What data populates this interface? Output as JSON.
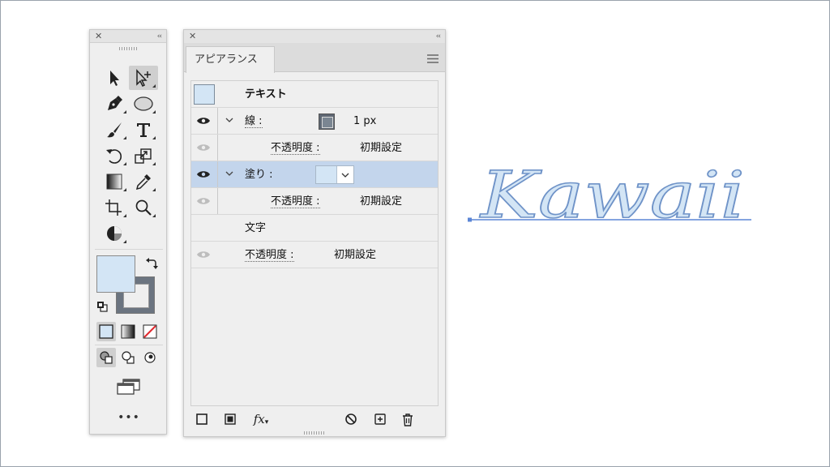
{
  "tools_panel": {
    "close_glyph": "✕",
    "collapse_glyph": "‹‹",
    "more_glyph": "•••",
    "icons": [
      "selection-tool-icon",
      "direct-selection-tool-icon",
      "pen-tool-icon",
      "ellipse-tool-icon",
      "paintbrush-tool-icon",
      "type-tool-icon",
      "rotate-tool-icon",
      "scale-tool-icon",
      "gradient-tool-icon",
      "eyedropper-tool-icon",
      "artboard-tool-icon",
      "zoom-tool-icon",
      "shape-builder-icon"
    ],
    "fill_color": "#d3e5f5",
    "stroke_color": "#6b7480"
  },
  "appearance_panel": {
    "close_glyph": "✕",
    "collapse_glyph": "‹‹",
    "tab_label": "アピアランス",
    "object_title": "テキスト",
    "rows": {
      "stroke_label": "線 :",
      "stroke_value": "1 px",
      "stroke_opacity_label": "不透明度 :",
      "stroke_opacity_value": "初期設定",
      "fill_label": "塗り :",
      "fill_opacity_label": "不透明度 :",
      "fill_opacity_value": "初期設定",
      "characters_label": "文字",
      "opacity_label": "不透明度 :",
      "opacity_value": "初期設定"
    },
    "fx_label": "fx",
    "highlight_color": "#c3d5ec",
    "fill_color": "#d3e5f5"
  },
  "artwork": {
    "text": "Kawaii",
    "fill_color": "#d3e5f5",
    "outline_color": "#6f93c8",
    "baseline_color": "#5b86d6"
  }
}
